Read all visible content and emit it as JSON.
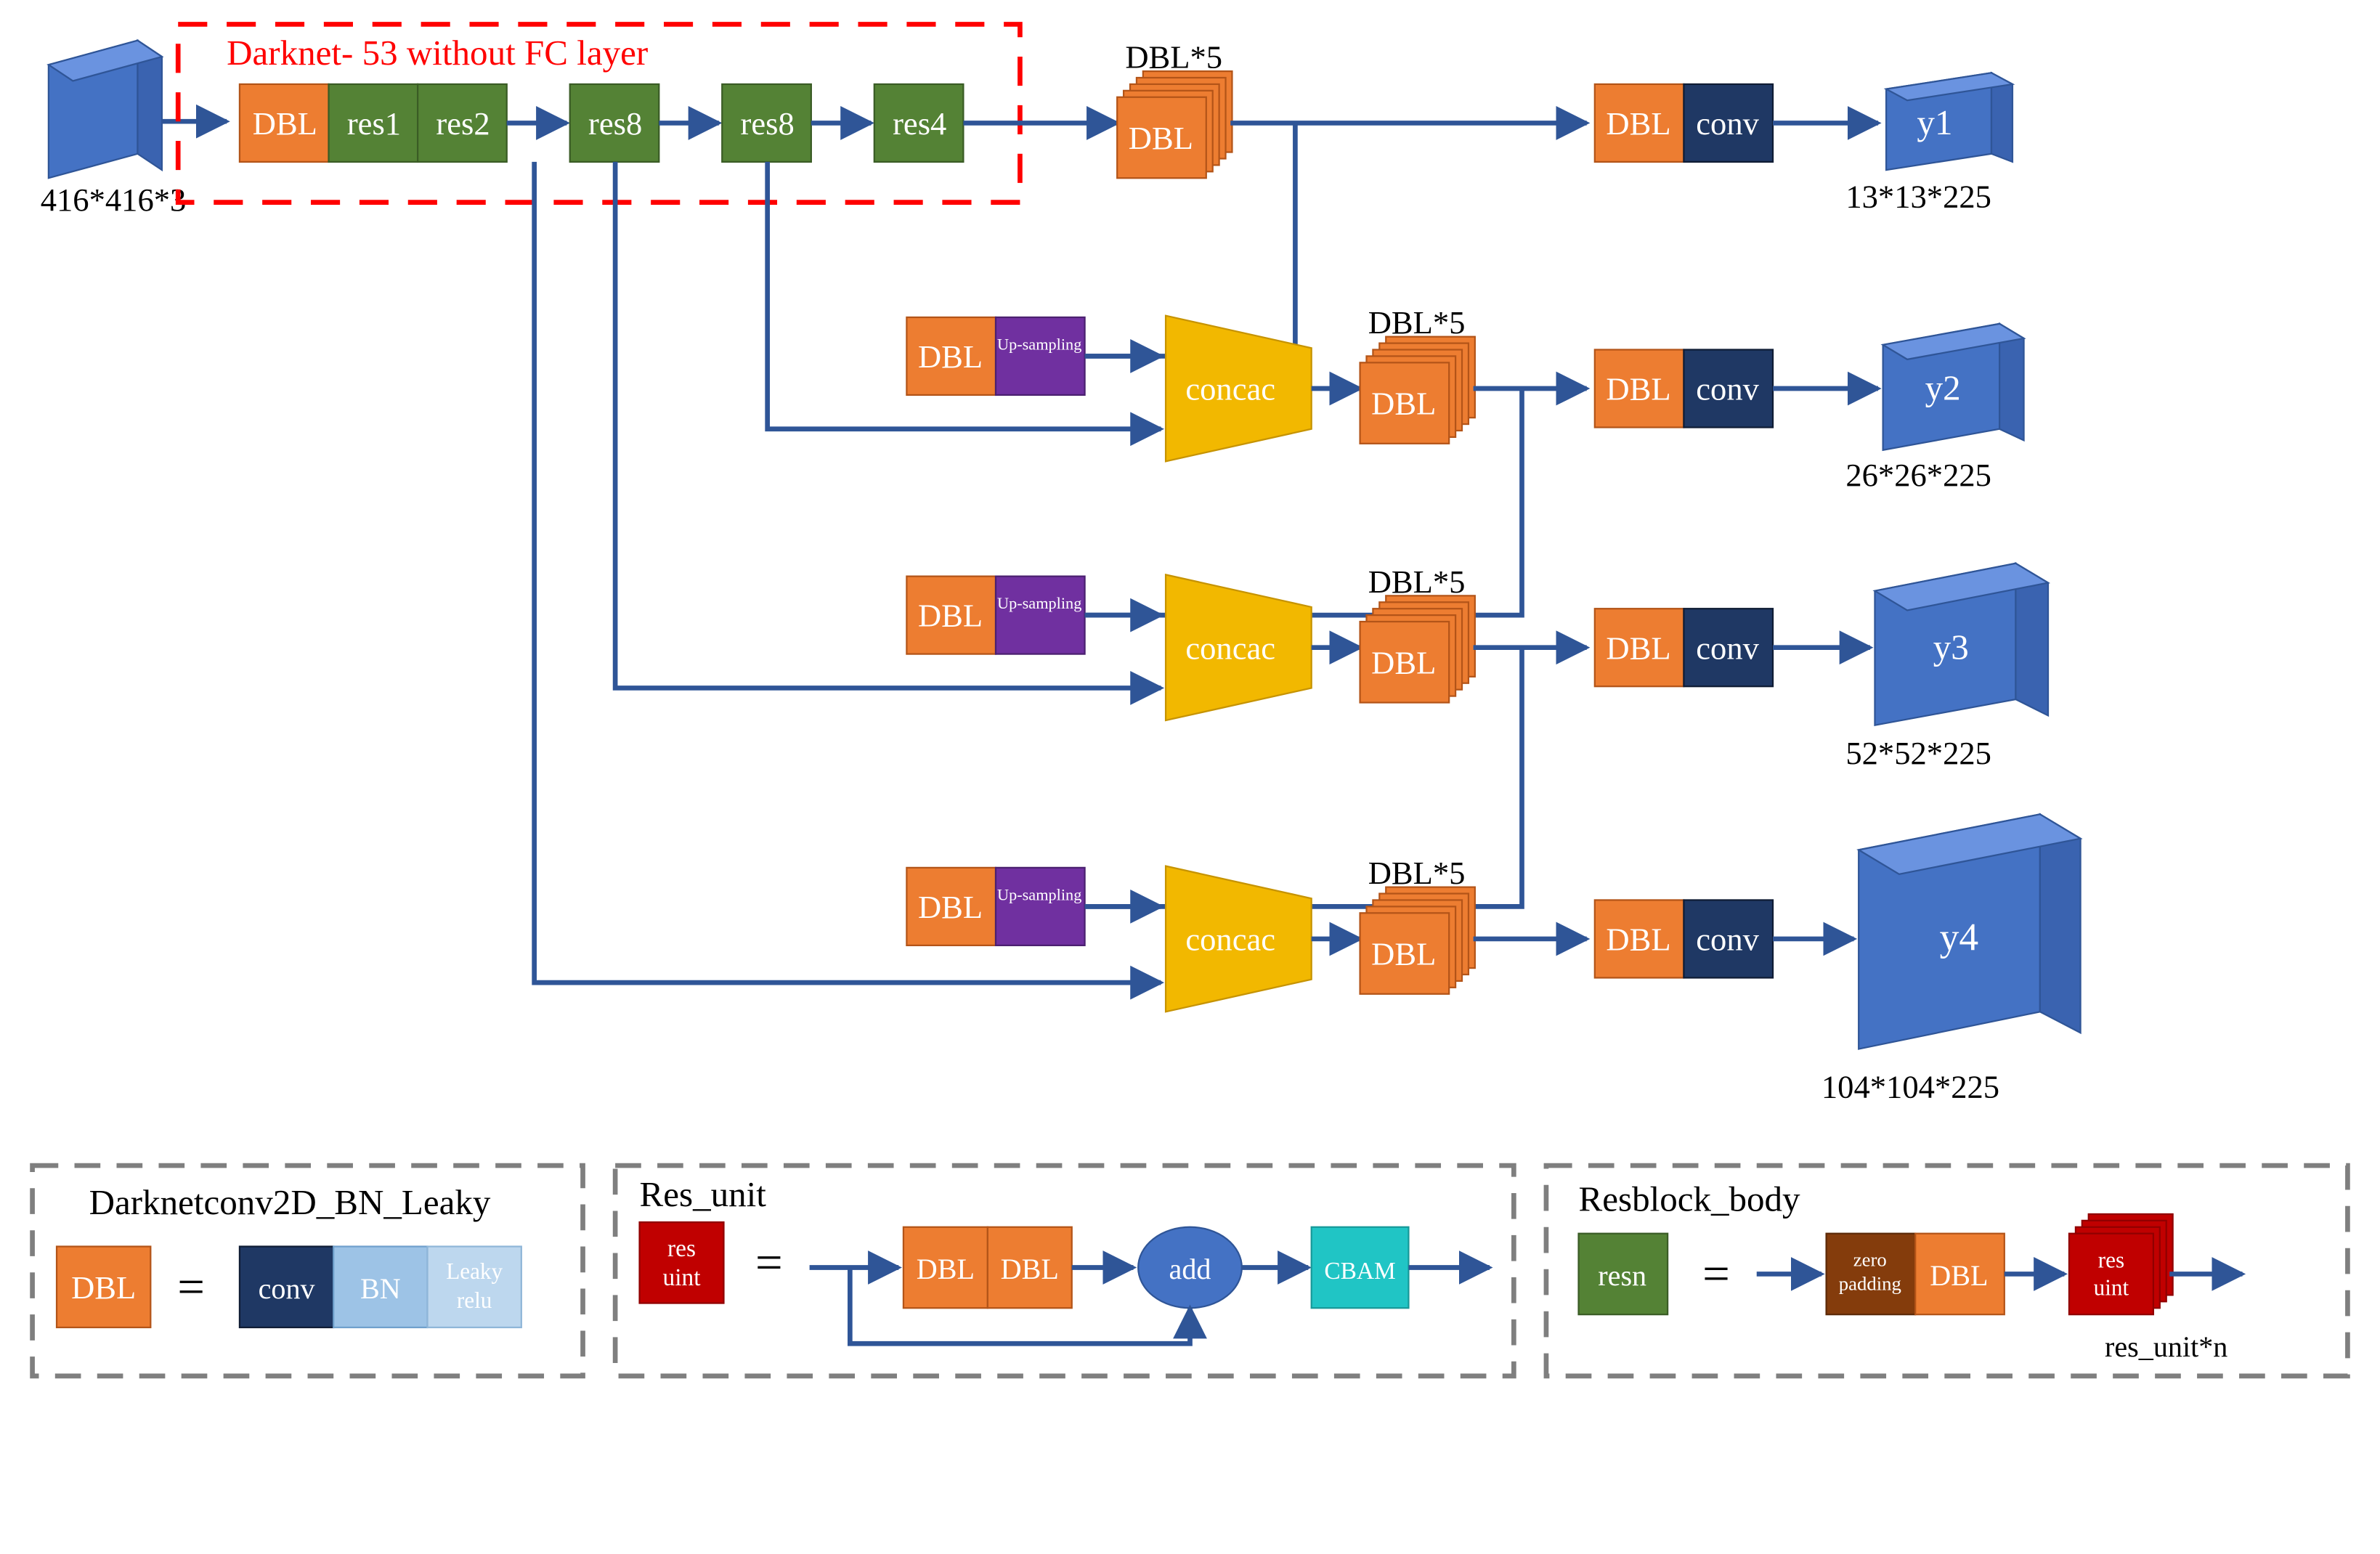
{
  "darknet_title": "Darknet- 53 without FC layer",
  "input_dim": "416*416*3",
  "backbone": {
    "dbl": "DBL",
    "res1": "res1",
    "res2": "res2",
    "res8a": "res8",
    "res8b": "res8",
    "res4": "res4"
  },
  "stage": {
    "dbl5_label": "DBL*5",
    "dbl_text": "DBL",
    "upsampling": "Up-sampling",
    "concac": "concac",
    "conv": "conv"
  },
  "outputs": {
    "y1": {
      "name": "y1",
      "dim": "13*13*225"
    },
    "y2": {
      "name": "y2",
      "dim": "26*26*225"
    },
    "y3": {
      "name": "y3",
      "dim": "52*52*225"
    },
    "y4": {
      "name": "y4",
      "dim": "104*104*225"
    }
  },
  "legend1": {
    "title": "Darknetconv2D_BN_Leaky",
    "dbl": "DBL",
    "eq": "=",
    "conv": "conv",
    "bn": "BN",
    "leaky": "Leaky relu"
  },
  "legend2": {
    "title": "Res_unit",
    "res_uint": "res uint",
    "eq": "=",
    "dbl": "DBL",
    "add": "add",
    "cbam": "CBAM"
  },
  "legend3": {
    "title": "Resblock_body",
    "resn": "resn",
    "eq": "=",
    "zero": "zero padding",
    "dbl": "DBL",
    "res_uint": "res uint",
    "caption": "res_unit*n"
  },
  "colors": {
    "orange": "#ED7D31",
    "green": "#548235",
    "blue": "#4472C4",
    "darknavy": "#1F3864",
    "purple": "#7030A0",
    "yellow": "#F2B800",
    "red": "#C00000",
    "lightblue": "#9DC3E6",
    "paleblue": "#BDD7EE",
    "teal": "#20C5C5",
    "brown": "#843C0C",
    "stroke_blue": "#2F5597",
    "red_stroke": "#FF0000",
    "grey": "#7F7F7F"
  }
}
